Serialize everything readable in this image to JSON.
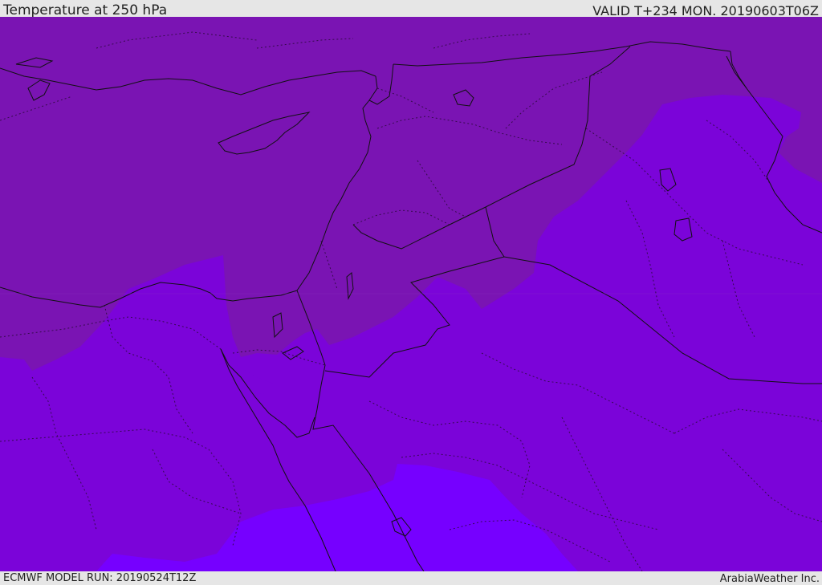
{
  "header": {
    "title": "Temperature at 250 hPa",
    "valid": "VALID T+234 MON. 20190603T06Z"
  },
  "footer": {
    "model_run": "ECMWF MODEL RUN: 20190524T12Z",
    "brand": "ArabiaWeather Inc."
  },
  "map": {
    "colors": {
      "zone_warm": "#7a14b3",
      "zone_mid": "#7b04d9",
      "zone_cold": "#7600ff",
      "coastline": "#111111",
      "border_dotted": "#2a0a3a"
    }
  }
}
